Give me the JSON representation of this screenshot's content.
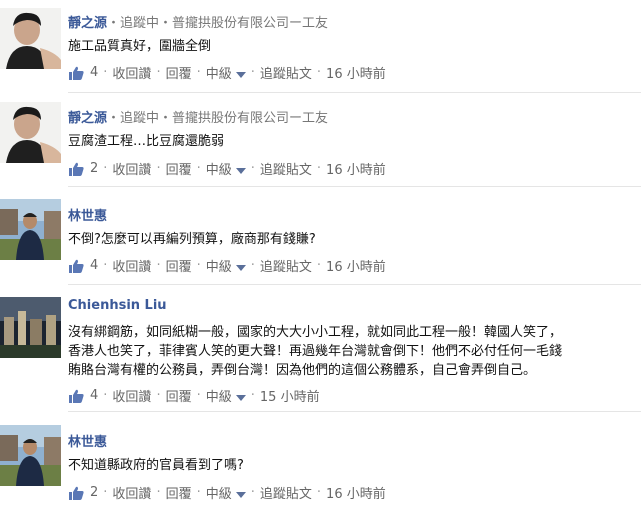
{
  "comments": [
    {
      "name": "靜之源",
      "meta": "・追蹤中・普攏拱股份有限公司ー工友",
      "text": "施工品質真好，圍牆全倒",
      "likes": "4",
      "unlike": "收回讚",
      "reply": "回覆",
      "level": "中級",
      "follow": "追蹤貼文",
      "time": "16 小時前"
    },
    {
      "name": "靜之源",
      "meta": "・追蹤中・普攏拱股份有限公司ー工友",
      "text": "豆腐渣工程…比豆腐還脆弱",
      "likes": "2",
      "unlike": "收回讚",
      "reply": "回覆",
      "level": "中級",
      "follow": "追蹤貼文",
      "time": "16 小時前"
    },
    {
      "name": "林世惠",
      "meta": "",
      "text": "不倒?怎麼可以再編列預算，廠商那有錢賺?",
      "likes": "4",
      "unlike": "收回讚",
      "reply": "回覆",
      "level": "中級",
      "follow": "追蹤貼文",
      "time": "16 小時前"
    },
    {
      "name": "Chienhsin Liu",
      "meta": "",
      "text_lines": [
        "沒有綁鋼筋，如同紙糊一般，國家的大大小小工程，就如同此工程一般！韓國人笑了，",
        "香港人也笑了，菲律賓人笑的更大聲！再過幾年台灣就會倒下！他們不必付任何一毛錢",
        "賄賂台灣有權的公務員，弄倒台灣！因為他們的這個公務體系，自己會弄倒自己。"
      ],
      "likes": "4",
      "unlike": "收回讚",
      "reply": "回覆",
      "level": "中級",
      "time": "15 小時前"
    },
    {
      "name": "林世惠",
      "meta": "",
      "text": "不知道縣政府的官員看到了嗎?",
      "likes": "2",
      "unlike": "收回讚",
      "reply": "回覆",
      "level": "中級",
      "follow": "追蹤貼文",
      "time": "16 小時前"
    }
  ],
  "colors": {
    "name": "#3b5998",
    "meta": "#777777",
    "divider": "#e5e5e5"
  },
  "icons": {
    "like": "thumbs-up-icon",
    "dropdown": "chevron-down-icon"
  }
}
